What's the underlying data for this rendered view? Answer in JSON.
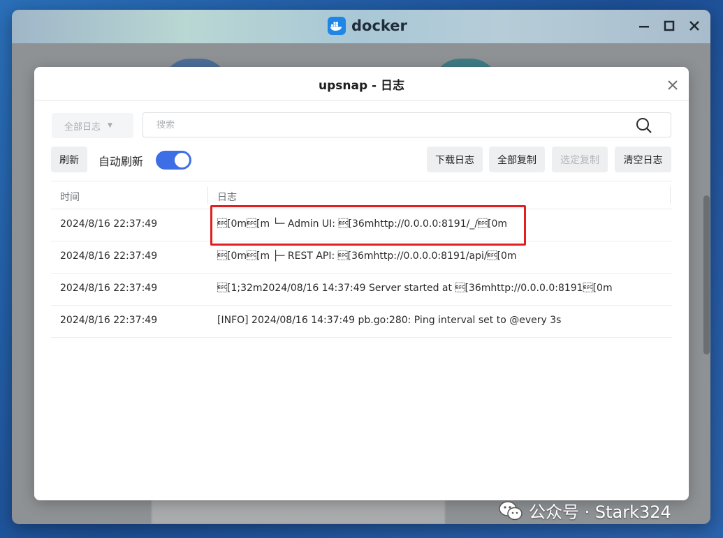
{
  "app": {
    "title": "docker",
    "accent": "#1f86e8"
  },
  "modal": {
    "title": "upsnap - 日志"
  },
  "toolbar": {
    "filter": {
      "selected": "全部日志"
    },
    "search": {
      "placeholder": "搜索"
    },
    "refresh_label": "刷新",
    "auto_refresh_label": "自动刷新",
    "auto_refresh_on": true,
    "download_label": "下载日志",
    "copy_all_label": "全部复制",
    "copy_selected_label": "选定复制",
    "clear_label": "清空日志"
  },
  "table": {
    "columns": [
      "时间",
      "日志"
    ],
    "rows": [
      {
        "time": "2024/8/16 22:37:49",
        "log": "\u001b[0m\u001b[m └─ Admin UI: \u001b[36mhttp://0.0.0.0:8191/_/\u001b[0m"
      },
      {
        "time": "2024/8/16 22:37:49",
        "log": "\u001b[0m\u001b[m ├─ REST API: \u001b[36mhttp://0.0.0.0:8191/api/\u001b[0m"
      },
      {
        "time": "2024/8/16 22:37:49",
        "log": "\u001b[1;32m2024/08/16 14:37:49 Server started at \u001b[36mhttp://0.0.0.0:8191\u001b[0m"
      },
      {
        "time": "2024/8/16 22:37:49",
        "log": "[INFO] 2024/08/16 14:37:49 pb.go:280: Ping interval set to @every 3s"
      }
    ],
    "highlight_color": "#e11f1f"
  },
  "watermark": {
    "text": "公众号 · Stark324"
  }
}
